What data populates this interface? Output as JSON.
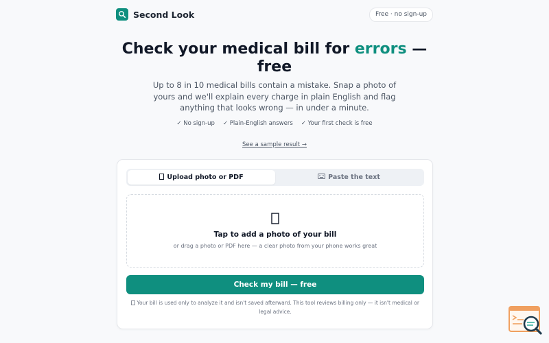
{
  "header": {
    "brand_name": "Second Look",
    "logo_icon": "magnifier-icon",
    "pill": "Free · no sign-up"
  },
  "hero": {
    "title_before": "Check your medical bill for ",
    "title_accent": "errors",
    "title_after": " — free",
    "subtitle": "Up to 8 in 10 medical bills contain a mistake. Snap a photo of yours and we'll explain every charge in plain English and flag anything that looks wrong — in under a minute.",
    "checks": [
      "✓ No sign-up",
      "✓ Plain-English answers",
      "✓ Your first check is free"
    ],
    "sample_link": "See a sample result →"
  },
  "card": {
    "tabs": [
      {
        "icon": "file-icon",
        "label": "Upload photo or PDF",
        "active": true
      },
      {
        "icon": "keyboard-icon",
        "label": "Paste the text",
        "active": false
      }
    ],
    "dropzone": {
      "icon": "file-icon",
      "title": "Tap to add a photo of your bill",
      "subtitle": "or drag a photo or PDF here — a clear photo from your phone works great"
    },
    "cta_label": "Check my bill — free",
    "disclaimer": "Your bill is used only to analyze it and isn't saved afterward. This tool reviews billing only — it isn't medical or legal advice.",
    "disclaimer_icon": "lock-icon"
  },
  "colors": {
    "accent": "#0f8f7f",
    "background": "#f8f9fb",
    "corner_badge_orange": "#f0a060"
  },
  "corner_badge_icon": "document-search-icon"
}
